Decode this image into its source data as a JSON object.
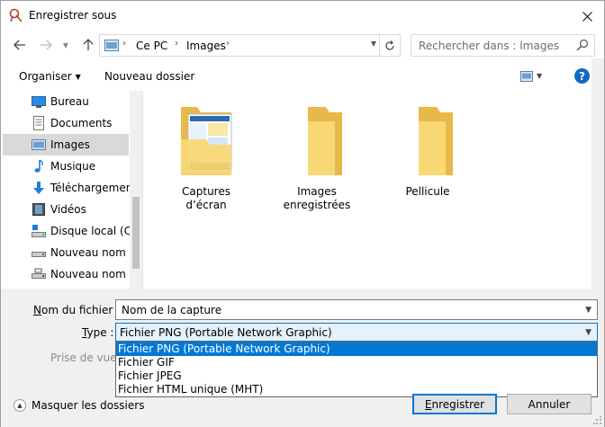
{
  "window": {
    "title": "Enregistrer sous"
  },
  "nav": {
    "breadcrumbs": [
      "Ce PC",
      "Images"
    ],
    "search_placeholder": "Rechercher dans : Images"
  },
  "toolbar": {
    "organize_label": "Organiser",
    "new_folder_label": "Nouveau dossier",
    "help_label": "?"
  },
  "sidebar": {
    "items": [
      {
        "label": "Bureau",
        "icon": "desktop-icon"
      },
      {
        "label": "Documents",
        "icon": "documents-icon"
      },
      {
        "label": "Images",
        "icon": "pictures-icon",
        "selected": true
      },
      {
        "label": "Musique",
        "icon": "music-icon"
      },
      {
        "label": "Téléchargements",
        "icon": "downloads-icon"
      },
      {
        "label": "Vidéos",
        "icon": "videos-icon"
      },
      {
        "label": "Disque local (C:)",
        "icon": "local-disk-icon"
      },
      {
        "label": "Nouveau nom (E",
        "icon": "drive-icon"
      },
      {
        "label": "Nouveau nom (E",
        "icon": "network-drive-icon"
      }
    ]
  },
  "folders": [
    {
      "label": "Captures d’écran",
      "has_preview": true
    },
    {
      "label": "Images enregistrées",
      "has_preview": false
    },
    {
      "label": "Pellicule",
      "has_preview": false
    }
  ],
  "form": {
    "filename_label_prefix": "N",
    "filename_label_rest": "om du fichier :",
    "filename_value": "Nom de la capture",
    "type_label_prefix": "T",
    "type_label_rest": "ype :",
    "type_value": "Fichier PNG (Portable Network Graphic)",
    "type_options": [
      "Fichier PNG (Portable Network Graphic)",
      "Fichier GIF",
      "Fichier JPEG",
      "Fichier HTML unique (MHT)"
    ],
    "type_selected_index": 0,
    "view_label": "Prise de vue :"
  },
  "footer": {
    "hide_folders_label": "Masquer les dossiers",
    "save_prefix": "E",
    "save_rest": "nregistrer",
    "cancel_label": "Annuler"
  },
  "colors": {
    "accent": "#0078d7",
    "folder": "#f8d775",
    "folder_dark": "#e8b949",
    "help": "#1167c9"
  }
}
